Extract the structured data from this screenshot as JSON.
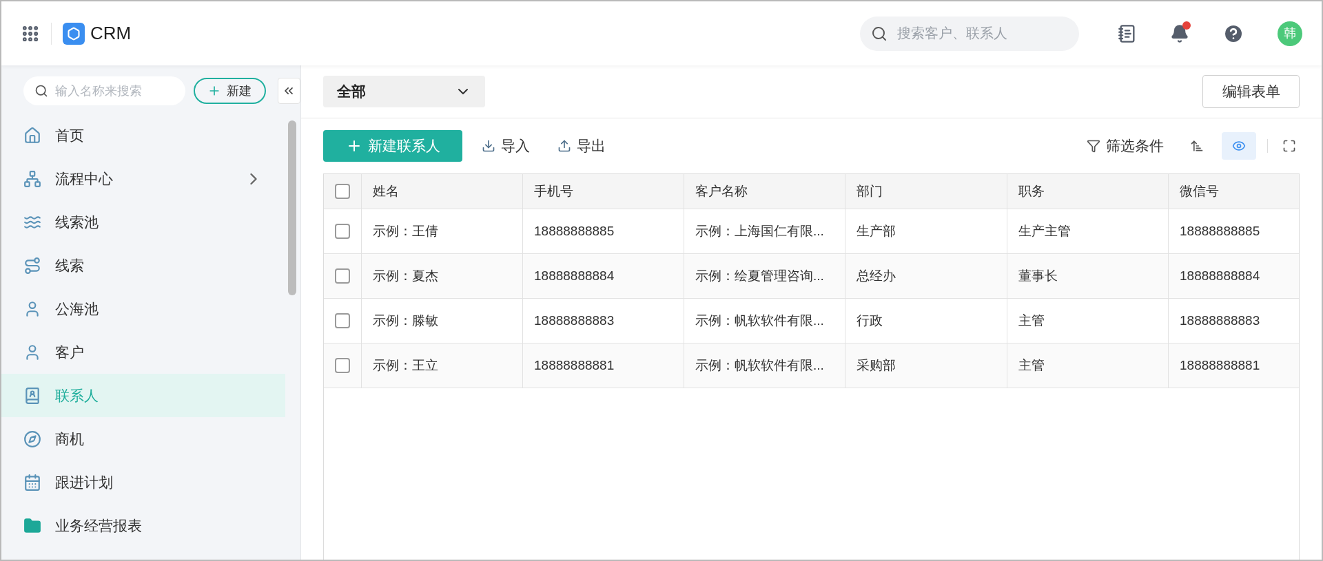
{
  "app": {
    "title": "CRM"
  },
  "header": {
    "search": {
      "placeholder": "搜索客户、联系人"
    },
    "avatar": "韩"
  },
  "sidebar": {
    "search": {
      "placeholder": "输入名称来搜索"
    },
    "new_button": "新建",
    "items": [
      {
        "label": "首页",
        "selected": false,
        "expandable": false
      },
      {
        "label": "流程中心",
        "selected": false,
        "expandable": true
      },
      {
        "label": "线索池",
        "selected": false,
        "expandable": false
      },
      {
        "label": "线索",
        "selected": false,
        "expandable": false
      },
      {
        "label": "公海池",
        "selected": false,
        "expandable": false
      },
      {
        "label": "客户",
        "selected": false,
        "expandable": false
      },
      {
        "label": "联系人",
        "selected": true,
        "expandable": false
      },
      {
        "label": "商机",
        "selected": false,
        "expandable": false
      },
      {
        "label": "跟进计划",
        "selected": false,
        "expandable": false
      },
      {
        "label": "业务经营报表",
        "selected": false,
        "expandable": false
      }
    ]
  },
  "view_select": {
    "value": "全部"
  },
  "edit_form_button": "编辑表单",
  "toolbar": {
    "new_contact": "新建联系人",
    "import": "导入",
    "export": "导出",
    "filter": "筛选条件",
    "preview_on": true
  },
  "table": {
    "all_selected": false,
    "columns": [
      "姓名",
      "手机号",
      "客户名称",
      "部门",
      "职务",
      "微信号"
    ],
    "rows": [
      {
        "selected": false,
        "cells": [
          "示例：王倩",
          "18888888885",
          "示例：上海国仁有限...",
          "生产部",
          "生产主管",
          "18888888885"
        ]
      },
      {
        "selected": false,
        "cells": [
          "示例：夏杰",
          "18888888884",
          "示例：绘夏管理咨询...",
          "总经办",
          "董事长",
          "18888888884"
        ]
      },
      {
        "selected": false,
        "cells": [
          "示例：滕敏",
          "18888888883",
          "示例：帆软软件有限...",
          "行政",
          "主管",
          "18888888883"
        ]
      },
      {
        "selected": false,
        "cells": [
          "示例：王立",
          "18888888881",
          "示例：帆软软件有限...",
          "采购部",
          "主管",
          "18888888881"
        ]
      }
    ]
  }
}
